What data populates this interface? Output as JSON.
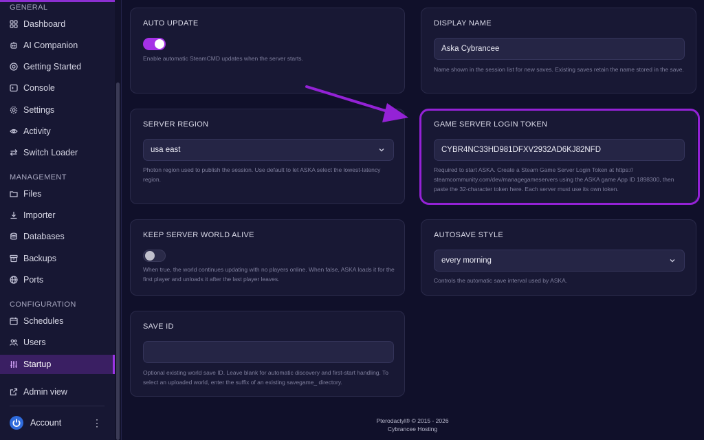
{
  "sidebar": {
    "sections": {
      "general": "GENERAL",
      "management": "MANAGEMENT",
      "configuration": "CONFIGURATION"
    },
    "items": {
      "dashboard": "Dashboard",
      "ai_companion": "AI Companion",
      "getting_started": "Getting Started",
      "console": "Console",
      "settings": "Settings",
      "activity": "Activity",
      "switch_loader": "Switch Loader",
      "files": "Files",
      "importer": "Importer",
      "databases": "Databases",
      "backups": "Backups",
      "ports": "Ports",
      "schedules": "Schedules",
      "users": "Users",
      "startup": "Startup",
      "admin_view": "Admin view"
    },
    "account_label": "Account",
    "active_item": "Startup",
    "accent_color": "#9b35e6"
  },
  "cards": {
    "auto_update": {
      "title": "AUTO UPDATE",
      "enabled": true,
      "description": "Enable automatic SteamCMD updates when the server starts."
    },
    "display_name": {
      "title": "DISPLAY NAME",
      "value": "Aska Cybrancee",
      "description": "Name shown in the session list for new saves. Existing saves retain the name stored in the save."
    },
    "server_region": {
      "title": "SERVER REGION",
      "value": "usa east",
      "description": "Photon region used to publish the session. Use default to let ASKA select the lowest-latency region."
    },
    "login_token": {
      "title": "GAME SERVER LOGIN TOKEN",
      "value": "CYBR4NC33HD981DFXV2932AD6KJ82NFD",
      "description": "Required to start ASKA. Create a Steam Game Server Login Token at https:// steamcommunity.com/dev/managegameservers using the ASKA game App ID 1898300, then paste the 32-character token here. Each server must use its own token."
    },
    "keep_alive": {
      "title": "KEEP SERVER WORLD ALIVE",
      "enabled": false,
      "description": "When true, the world continues updating with no players online. When false, ASKA loads it for the first player and unloads it after the last player leaves."
    },
    "autosave": {
      "title": "AUTOSAVE STYLE",
      "value": "every morning",
      "description": "Controls the automatic save interval used by ASKA."
    },
    "save_id": {
      "title": "SAVE ID",
      "value": "",
      "description": "Optional existing world save ID. Leave blank for automatic discovery and first-start handling. To select an uploaded world, enter the suffix of an existing savegame_ directory."
    }
  },
  "footer": {
    "line1": "Pterodactyl® © 2015 - 2026",
    "line2": "Cybrancee Hosting"
  },
  "annotation_color": "#9422d6"
}
